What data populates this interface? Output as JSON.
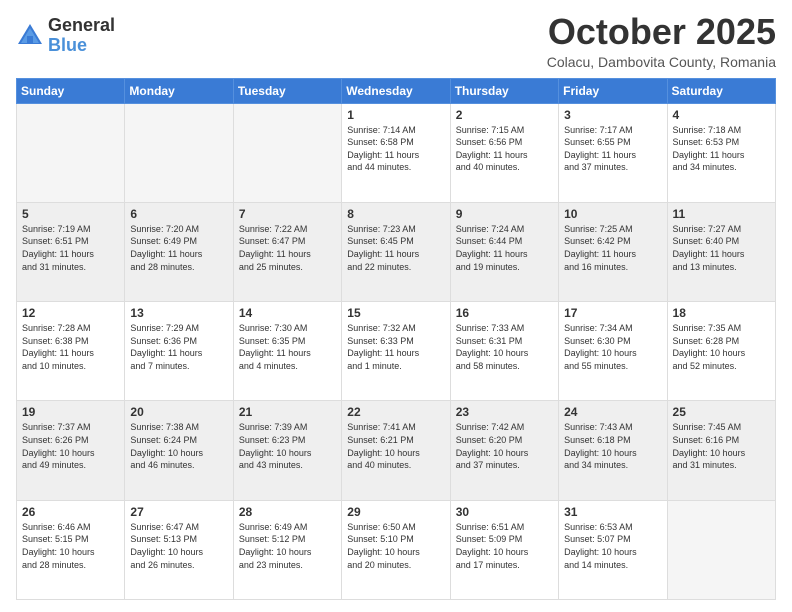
{
  "header": {
    "logo_general": "General",
    "logo_blue": "Blue",
    "month_title": "October 2025",
    "location": "Colacu, Dambovita County, Romania"
  },
  "days_of_week": [
    "Sunday",
    "Monday",
    "Tuesday",
    "Wednesday",
    "Thursday",
    "Friday",
    "Saturday"
  ],
  "weeks": [
    [
      {
        "day": "",
        "info": ""
      },
      {
        "day": "",
        "info": ""
      },
      {
        "day": "",
        "info": ""
      },
      {
        "day": "1",
        "info": "Sunrise: 7:14 AM\nSunset: 6:58 PM\nDaylight: 11 hours\nand 44 minutes."
      },
      {
        "day": "2",
        "info": "Sunrise: 7:15 AM\nSunset: 6:56 PM\nDaylight: 11 hours\nand 40 minutes."
      },
      {
        "day": "3",
        "info": "Sunrise: 7:17 AM\nSunset: 6:55 PM\nDaylight: 11 hours\nand 37 minutes."
      },
      {
        "day": "4",
        "info": "Sunrise: 7:18 AM\nSunset: 6:53 PM\nDaylight: 11 hours\nand 34 minutes."
      }
    ],
    [
      {
        "day": "5",
        "info": "Sunrise: 7:19 AM\nSunset: 6:51 PM\nDaylight: 11 hours\nand 31 minutes."
      },
      {
        "day": "6",
        "info": "Sunrise: 7:20 AM\nSunset: 6:49 PM\nDaylight: 11 hours\nand 28 minutes."
      },
      {
        "day": "7",
        "info": "Sunrise: 7:22 AM\nSunset: 6:47 PM\nDaylight: 11 hours\nand 25 minutes."
      },
      {
        "day": "8",
        "info": "Sunrise: 7:23 AM\nSunset: 6:45 PM\nDaylight: 11 hours\nand 22 minutes."
      },
      {
        "day": "9",
        "info": "Sunrise: 7:24 AM\nSunset: 6:44 PM\nDaylight: 11 hours\nand 19 minutes."
      },
      {
        "day": "10",
        "info": "Sunrise: 7:25 AM\nSunset: 6:42 PM\nDaylight: 11 hours\nand 16 minutes."
      },
      {
        "day": "11",
        "info": "Sunrise: 7:27 AM\nSunset: 6:40 PM\nDaylight: 11 hours\nand 13 minutes."
      }
    ],
    [
      {
        "day": "12",
        "info": "Sunrise: 7:28 AM\nSunset: 6:38 PM\nDaylight: 11 hours\nand 10 minutes."
      },
      {
        "day": "13",
        "info": "Sunrise: 7:29 AM\nSunset: 6:36 PM\nDaylight: 11 hours\nand 7 minutes."
      },
      {
        "day": "14",
        "info": "Sunrise: 7:30 AM\nSunset: 6:35 PM\nDaylight: 11 hours\nand 4 minutes."
      },
      {
        "day": "15",
        "info": "Sunrise: 7:32 AM\nSunset: 6:33 PM\nDaylight: 11 hours\nand 1 minute."
      },
      {
        "day": "16",
        "info": "Sunrise: 7:33 AM\nSunset: 6:31 PM\nDaylight: 10 hours\nand 58 minutes."
      },
      {
        "day": "17",
        "info": "Sunrise: 7:34 AM\nSunset: 6:30 PM\nDaylight: 10 hours\nand 55 minutes."
      },
      {
        "day": "18",
        "info": "Sunrise: 7:35 AM\nSunset: 6:28 PM\nDaylight: 10 hours\nand 52 minutes."
      }
    ],
    [
      {
        "day": "19",
        "info": "Sunrise: 7:37 AM\nSunset: 6:26 PM\nDaylight: 10 hours\nand 49 minutes."
      },
      {
        "day": "20",
        "info": "Sunrise: 7:38 AM\nSunset: 6:24 PM\nDaylight: 10 hours\nand 46 minutes."
      },
      {
        "day": "21",
        "info": "Sunrise: 7:39 AM\nSunset: 6:23 PM\nDaylight: 10 hours\nand 43 minutes."
      },
      {
        "day": "22",
        "info": "Sunrise: 7:41 AM\nSunset: 6:21 PM\nDaylight: 10 hours\nand 40 minutes."
      },
      {
        "day": "23",
        "info": "Sunrise: 7:42 AM\nSunset: 6:20 PM\nDaylight: 10 hours\nand 37 minutes."
      },
      {
        "day": "24",
        "info": "Sunrise: 7:43 AM\nSunset: 6:18 PM\nDaylight: 10 hours\nand 34 minutes."
      },
      {
        "day": "25",
        "info": "Sunrise: 7:45 AM\nSunset: 6:16 PM\nDaylight: 10 hours\nand 31 minutes."
      }
    ],
    [
      {
        "day": "26",
        "info": "Sunrise: 6:46 AM\nSunset: 5:15 PM\nDaylight: 10 hours\nand 28 minutes."
      },
      {
        "day": "27",
        "info": "Sunrise: 6:47 AM\nSunset: 5:13 PM\nDaylight: 10 hours\nand 26 minutes."
      },
      {
        "day": "28",
        "info": "Sunrise: 6:49 AM\nSunset: 5:12 PM\nDaylight: 10 hours\nand 23 minutes."
      },
      {
        "day": "29",
        "info": "Sunrise: 6:50 AM\nSunset: 5:10 PM\nDaylight: 10 hours\nand 20 minutes."
      },
      {
        "day": "30",
        "info": "Sunrise: 6:51 AM\nSunset: 5:09 PM\nDaylight: 10 hours\nand 17 minutes."
      },
      {
        "day": "31",
        "info": "Sunrise: 6:53 AM\nSunset: 5:07 PM\nDaylight: 10 hours\nand 14 minutes."
      },
      {
        "day": "",
        "info": ""
      }
    ]
  ]
}
